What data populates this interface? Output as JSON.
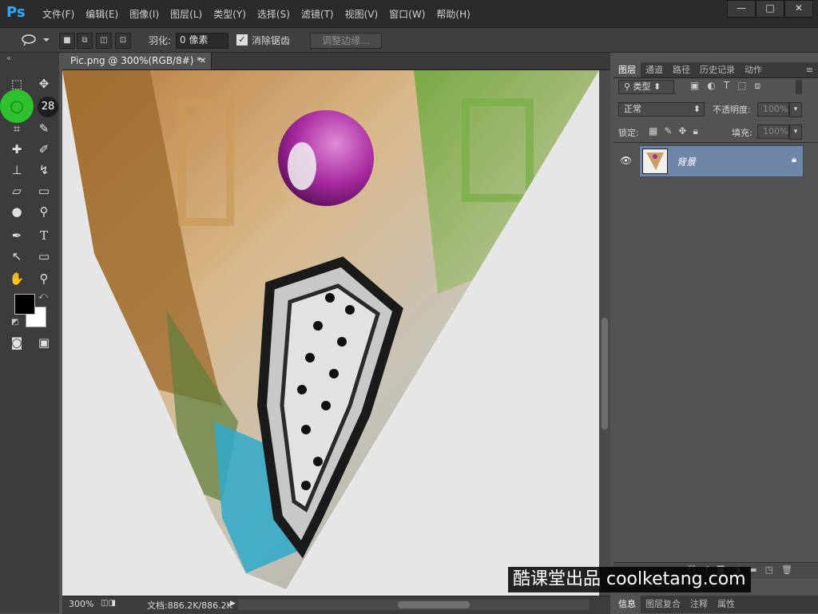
{
  "app": {
    "logo": "Ps"
  },
  "menu": [
    "文件(F)",
    "编辑(E)",
    "图像(I)",
    "图层(L)",
    "类型(Y)",
    "选择(S)",
    "滤镜(T)",
    "视图(V)",
    "窗口(W)",
    "帮助(H)"
  ],
  "window_controls": {
    "minimize": "—",
    "restore": "□",
    "close": "✕"
  },
  "options": {
    "feather_label": "羽化:",
    "feather_value": "0 像素",
    "antialias_label": "消除锯齿",
    "refine_edge_label": "调整边缘..."
  },
  "toolbox": {
    "tool_number": "28"
  },
  "document": {
    "tab_title": "Pic.png @ 300%(RGB/8#) *",
    "close_symbol": "✕"
  },
  "status": {
    "zoom": "300%",
    "doc_info": "文档:886.2K/886.2K"
  },
  "layers_panel": {
    "tabs": [
      "图层",
      "通道",
      "路径",
      "历史记录",
      "动作"
    ],
    "filter_label": "类型",
    "blend_mode": "正常",
    "opacity_label": "不透明度:",
    "opacity_value": "100%",
    "lock_label": "锁定:",
    "fill_label": "填充:",
    "fill_value": "100%",
    "layer_name": "背景"
  },
  "bottom_tabs": [
    "信息",
    "图层复合",
    "注释",
    "属性"
  ],
  "watermark": "酷课堂出品 coolketang.com",
  "colors": {
    "accent": "#31a8ff",
    "highlight": "#2ec12e",
    "layer_selected": "#6f86a8"
  }
}
